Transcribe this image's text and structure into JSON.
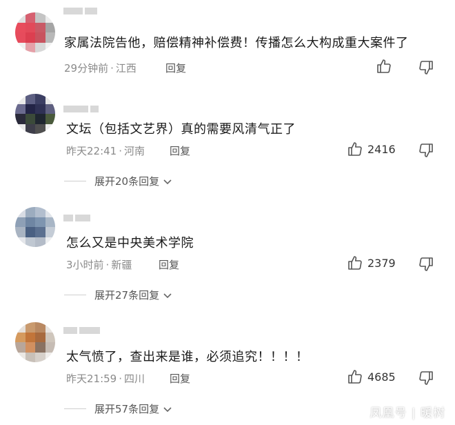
{
  "comments": [
    {
      "text": "家属法院告他，赔偿精神补偿费！传播怎么大构成重大案件了",
      "time": "29分钟前",
      "location": "江西",
      "reply_label": "回复",
      "likes": "",
      "expand_label": ""
    },
    {
      "text": "文坛（包括文艺界）真的需要风清气正了",
      "time": "昨天22:41",
      "location": "河南",
      "reply_label": "回复",
      "likes": "2416",
      "expand_label": "展开20条回复"
    },
    {
      "text": "怎么又是中央美术学院",
      "time": "3小时前",
      "location": "新疆",
      "reply_label": "回复",
      "likes": "2379",
      "expand_label": "展开27条回复"
    },
    {
      "text": "太气愤了，查出来是谁，必须追究！！！！",
      "time": "昨天21:59",
      "location": "四川",
      "reply_label": "回复",
      "likes": "4685",
      "expand_label": "展开57条回复"
    }
  ],
  "separator": "·",
  "watermark": "凤凰号 | 暖树",
  "icons": {
    "like": "thumbs-up-icon",
    "dislike": "thumbs-down-icon",
    "expand": "chevron-down-icon"
  }
}
